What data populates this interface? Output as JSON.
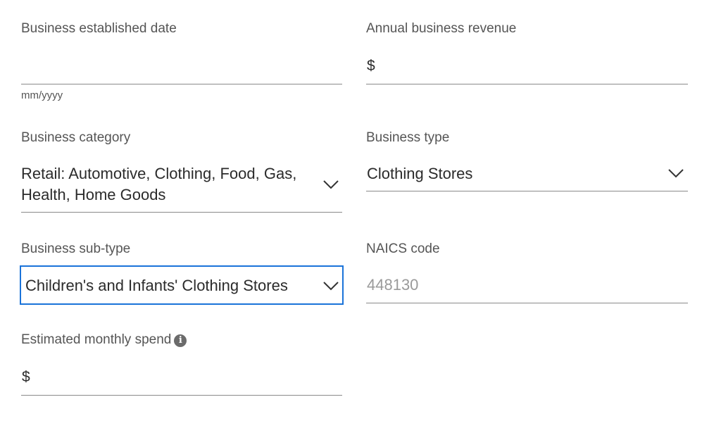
{
  "established_date": {
    "label": "Business established date",
    "value": "",
    "helper": "mm/yyyy"
  },
  "annual_revenue": {
    "label": "Annual business revenue",
    "currency_symbol": "$",
    "value": ""
  },
  "category": {
    "label": "Business category",
    "selected_line1": "Retail: Automotive, Clothing, Food, Gas,",
    "selected_line2": "Health, Home Goods",
    "icon": "chevron-down-icon"
  },
  "business_type": {
    "label": "Business type",
    "selected": "Clothing Stores",
    "icon": "chevron-down-icon"
  },
  "sub_type": {
    "label": "Business sub-type",
    "selected": "Children's and Infants' Clothing Stores",
    "icon": "chevron-down-icon",
    "focus_color": "#1a73d9"
  },
  "naics": {
    "label": "NAICS code",
    "value": "448130"
  },
  "monthly_spend": {
    "label": "Estimated monthly spend",
    "info_icon": "info-icon",
    "info_glyph": "i",
    "currency_symbol": "$",
    "value": ""
  }
}
